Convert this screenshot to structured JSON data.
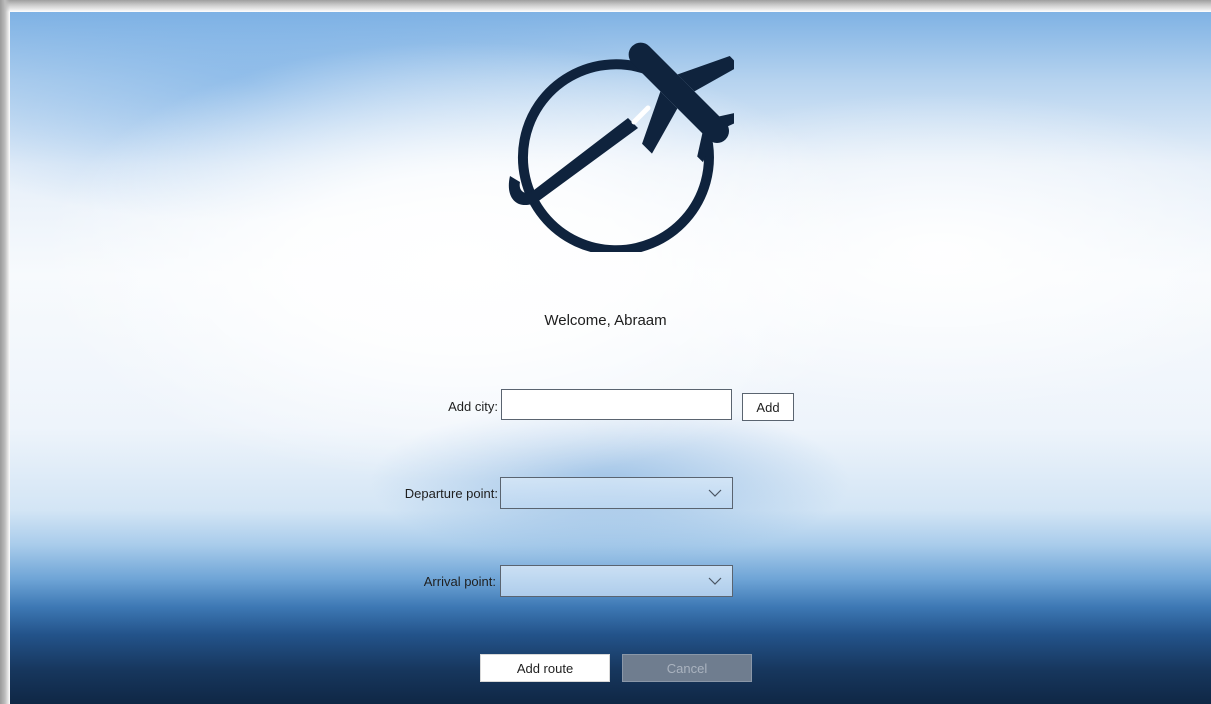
{
  "app": {
    "logo_icon": "airplane-globe-icon"
  },
  "header": {
    "welcome_text": "Welcome, Abraam"
  },
  "form": {
    "add_city": {
      "label": "Add city:",
      "value": "",
      "button_label": "Add"
    },
    "departure": {
      "label": "Departure point:",
      "selected": ""
    },
    "arrival": {
      "label": "Arrival point:",
      "selected": ""
    }
  },
  "actions": {
    "add_route_label": "Add route",
    "cancel_label": "Cancel"
  },
  "colors": {
    "logo": "#0f233d",
    "sky_top": "#7fb2e4",
    "sky_bottom": "#0f2745",
    "cancel_bg": "#6f7d8f"
  }
}
